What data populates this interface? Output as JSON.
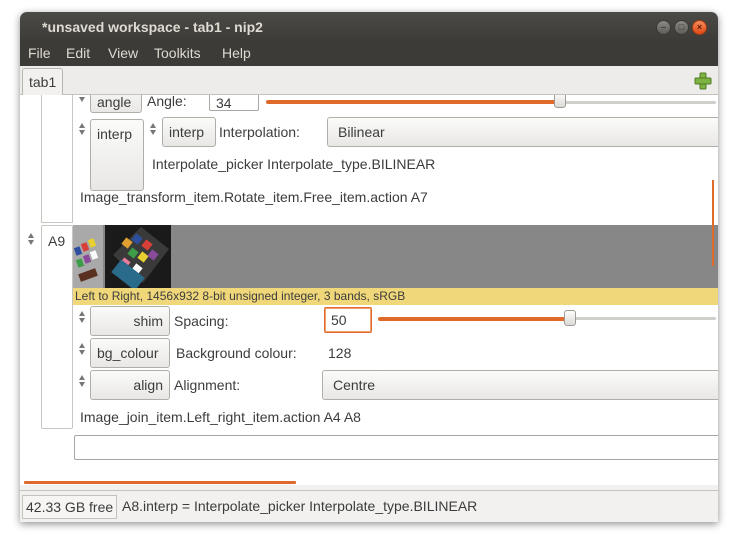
{
  "window": {
    "title": "*unsaved workspace - tab1 - nip2"
  },
  "menu": [
    "File",
    "Edit",
    "View",
    "Toolkits",
    "Help"
  ],
  "tabs": [
    {
      "label": "tab1"
    }
  ],
  "rotate": {
    "angle_button": "angle",
    "angle_label": "Angle:",
    "angle_value": "34",
    "angle_fraction": 0.65,
    "interp_button": "interp",
    "interp_option_button": "interp",
    "interp_label": "Interpolation:",
    "interp_value": "Bilinear",
    "interp_desc": "Interpolate_picker Interpolate_type.BILINEAR",
    "action": "Image_transform_item.Rotate_item.Free_item.action A7"
  },
  "row_a9": {
    "name": "A9",
    "caption": "Left to Right, 1456x932 8-bit unsigned integer, 3 bands, sRGB",
    "shim_button": "shim",
    "spacing_label": "Spacing:",
    "spacing_value": "50",
    "spacing_fraction": 0.5,
    "bg_button": "bg_colour",
    "bg_label": "Background colour:",
    "bg_value": "128",
    "align_button": "align",
    "align_label": "Alignment:",
    "align_value": "Centre",
    "action": "Image_join_item.Left_right_item.action A4 A8"
  },
  "status": {
    "free": "42.33 GB free",
    "message": "A8.interp = Interpolate_picker Interpolate_type.BILINEAR"
  },
  "colors": {
    "accent": "#e06a2c",
    "titlebar": "#3c3b37",
    "caption_bg": "#f0d87a"
  }
}
